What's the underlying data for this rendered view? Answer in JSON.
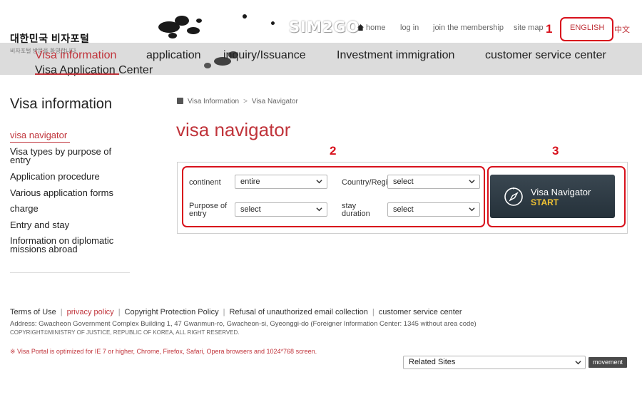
{
  "header": {
    "logo_text": "대한민국 비자포털",
    "logo_sub": "비자포털 방문을 환영합니다",
    "brand_watermark": "SIM2GO",
    "util_nav": [
      "home",
      "log in",
      "join the membership",
      "site map",
      "ENGLISH",
      "中文"
    ],
    "gnb": [
      "Visa information",
      "application",
      "inquiry/Issuance",
      "Investment immigration",
      "customer service center"
    ],
    "sub_gnb": "Visa Application Center"
  },
  "sidebar": {
    "title": "Visa information",
    "items": [
      "visa navigator",
      "Visa types by purpose of entry",
      "Application procedure",
      "Various application forms",
      "charge",
      "Entry and stay",
      "Information on diplomatic missions abroad"
    ]
  },
  "breadcrumb": [
    "Visa Information",
    "Visa Navigator"
  ],
  "page_title": "visa navigator",
  "annotations": [
    "1",
    "2",
    "3"
  ],
  "form": {
    "continent_label": "continent",
    "continent_value": "entire",
    "country_label": "Country/Regi",
    "country_value": "select",
    "purpose_label_1": "Purpose of",
    "purpose_label_2": "entry",
    "purpose_value": "select",
    "stay_label_1": "stay",
    "stay_label_2": "duration",
    "stay_value": "select"
  },
  "start_button": {
    "line1": "Visa Navigator",
    "line2": "START"
  },
  "footer": {
    "links": [
      "Terms of Use",
      "privacy policy",
      "Copyright Protection Policy",
      "Refusal of unauthorized email collection",
      "customer service center"
    ],
    "address": "Address: Gwacheon Government Complex Building 1, 47 Gwanmun-ro, Gwacheon-si, Gyeonggi-do (Foreigner Information Center: 1345 without area code)",
    "copyright": "COPYRIGHT©MINISTRY OF JUSTICE, REPUBLIC OF KOREA, ALL RIGHT RESERVED.",
    "browser_note": "※ Visa Portal is optimized for IE 7 or higher, Chrome, Firefox, Safari, Opera browsers and 1024*768 screen.",
    "related_sites": "Related Sites",
    "movement_label": "movement"
  },
  "colors": {
    "accent": "#c0343b",
    "annotation_red": "#d8111c",
    "button_dark": "#2d3942",
    "button_start": "#f0c233"
  }
}
